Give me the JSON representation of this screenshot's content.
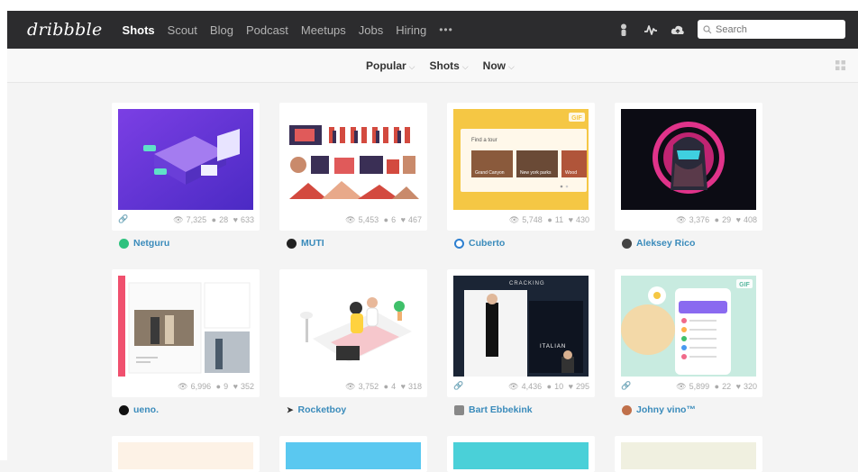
{
  "topbar": {
    "logo": "dribbble",
    "nav": [
      "Shots",
      "Scout",
      "Blog",
      "Podcast",
      "Meetups",
      "Jobs",
      "Hiring"
    ],
    "more": "•••",
    "search_placeholder": "Search"
  },
  "filters": [
    {
      "label": "Popular"
    },
    {
      "label": "Shots"
    },
    {
      "label": "Now"
    }
  ],
  "shots": [
    {
      "views": "7,325",
      "comments": "28",
      "likes": "633",
      "author": "Netguru",
      "gif": false,
      "linked": true
    },
    {
      "views": "5,453",
      "comments": "6",
      "likes": "467",
      "author": "MUTI",
      "gif": false,
      "linked": false
    },
    {
      "views": "5,748",
      "comments": "11",
      "likes": "430",
      "author": "Cuberto",
      "gif": true,
      "gif_label": "GIF",
      "linked": false,
      "tour_label": "Find a tour",
      "places": [
        "Grand Canyon",
        "New york parks",
        "Wood"
      ]
    },
    {
      "views": "3,376",
      "comments": "29",
      "likes": "408",
      "author": "Aleksey Rico",
      "gif": false,
      "linked": false
    },
    {
      "views": "6,996",
      "comments": "9",
      "likes": "352",
      "author": "ueno.",
      "gif": false,
      "linked": false
    },
    {
      "views": "3,752",
      "comments": "4",
      "likes": "318",
      "author": "Rocketboy",
      "gif": false,
      "linked": false
    },
    {
      "views": "4,436",
      "comments": "10",
      "likes": "295",
      "author": "Bart Ebbekink",
      "gif": false,
      "linked": true,
      "heading": "CRACKING",
      "sub": "ITALIAN"
    },
    {
      "views": "5,899",
      "comments": "22",
      "likes": "320",
      "author": "Johny vino™",
      "gif": true,
      "gif_label": "GIF",
      "linked": true
    }
  ]
}
